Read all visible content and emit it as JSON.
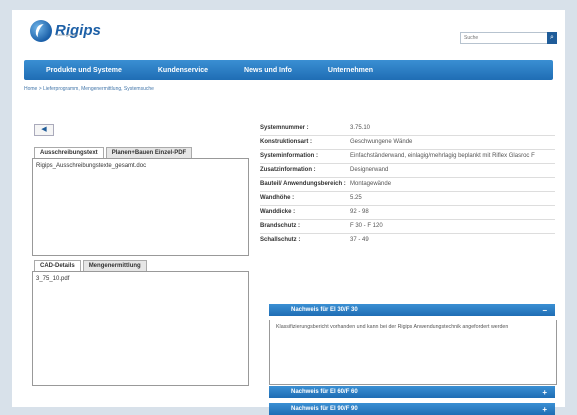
{
  "brand": {
    "name": "Rigips",
    "tagline": "saint-gobain"
  },
  "search": {
    "placeholder": "Suche",
    "icon": "search-icon"
  },
  "nav": [
    "Produkte und Systeme",
    "Kundenservice",
    "News und Info",
    "Unternehmen"
  ],
  "breadcrumb": "Home > Lieferprogramm, Mengenermittlung, Systemsuche",
  "back": {
    "label": "◀"
  },
  "tabs_top": [
    "Ausschreibungstext",
    "Planen+Bauen Einzel-PDF"
  ],
  "doc_file": "Rigips_Ausschreibungstexte_gesamt.doc",
  "tabs_bottom": [
    "CAD-Details",
    "Mengenermittlung"
  ],
  "cad_file": "3_75_10.pdf",
  "info": [
    {
      "k": "Systemnummer :",
      "v": "3.75.10"
    },
    {
      "k": "Konstruktionsart :",
      "v": "Geschwungene Wände"
    },
    {
      "k": "Systeminformation :",
      "v": "Einfachständerwand, einlagig/mehrlagig beplankt mit Riflex Glasroc F"
    },
    {
      "k": "Zusatzinformation :",
      "v": "Designerwand"
    },
    {
      "k": "Bauteil/ Anwendungsbereich :",
      "v": "Montagewände"
    },
    {
      "k": "Wandhöhe :",
      "v": "5.25"
    },
    {
      "k": "Wanddicke :",
      "v": "92 - 98"
    },
    {
      "k": "Brandschutz :",
      "v": "F 30 - F 120"
    },
    {
      "k": "Schallschutz :",
      "v": "37 - 49"
    }
  ],
  "accordion": [
    {
      "title": "Nachweis für EI 30/F 30",
      "sign": "−",
      "open": true,
      "text": "Klassifizierungsbericht vorhanden und kann bei der Rigips Anwendungstechnik angefordert werden"
    },
    {
      "title": "Nachweis für EI 60/F 60",
      "sign": "+"
    },
    {
      "title": "Nachweis für EI 90/F 90",
      "sign": "+"
    }
  ]
}
